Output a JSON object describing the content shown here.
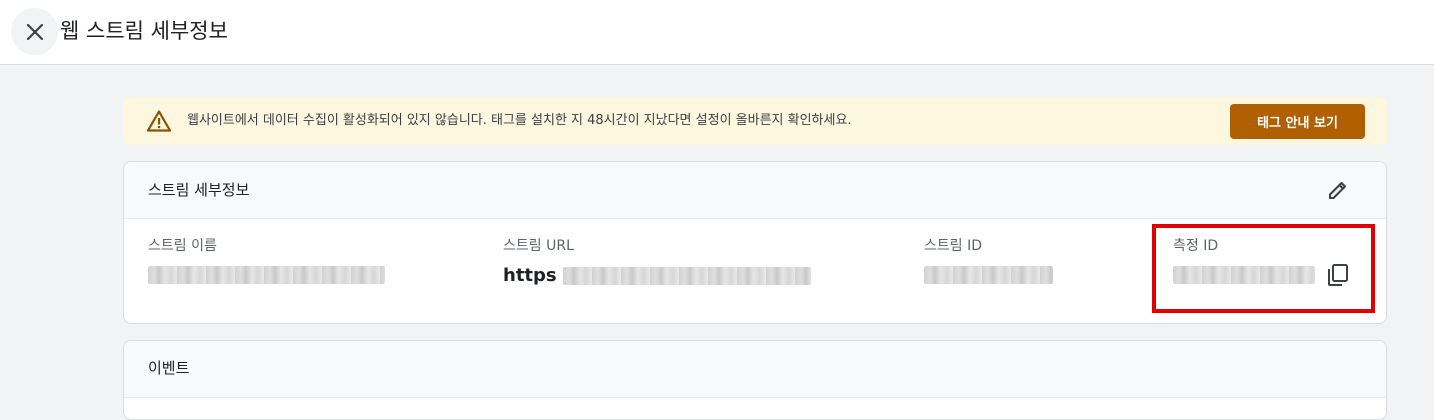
{
  "header": {
    "title": "웹 스트림 세부정보"
  },
  "banner": {
    "message": "웹사이트에서 데이터 수집이 활성화되어 있지 않습니다. 태그를 설치한 지 48시간이 지났다면 설정이 올바른지 확인하세요.",
    "button_label": "태그 안내 보기"
  },
  "stream_details": {
    "title": "스트림 세부정보",
    "fields": {
      "stream_name_label": "스트림 이름",
      "stream_url_label": "스트림 URL",
      "stream_url_prefix": "https",
      "stream_id_label": "스트림 ID",
      "measurement_id_label": "측정 ID"
    }
  },
  "events": {
    "title": "이벤트"
  },
  "colors": {
    "warning_bg": "#fef7e0",
    "warning_button": "#b06000",
    "highlight_border": "#e00000"
  }
}
